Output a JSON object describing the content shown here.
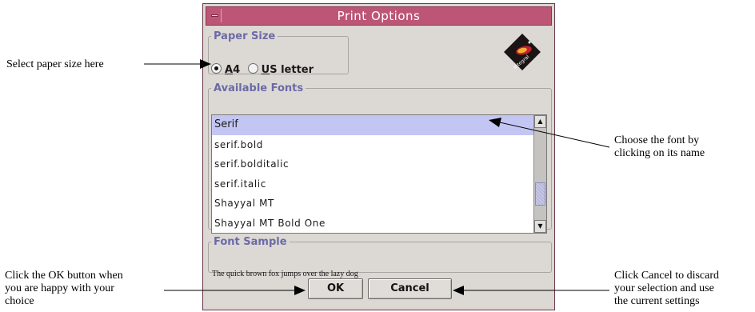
{
  "window": {
    "title": "Print Options"
  },
  "paper_size": {
    "legend": "Paper Size",
    "options": [
      {
        "label_underlined": "A",
        "label_rest": "4",
        "checked": true
      },
      {
        "label_underlined": "U",
        "label_rest": "S letter",
        "checked": false
      }
    ]
  },
  "logo": {
    "text": "Integral"
  },
  "fonts": {
    "legend": "Available Fonts",
    "items": [
      "Serif",
      "serif.bold",
      "serif.bolditalic",
      "serif.italic",
      "Shayyal MT",
      "Shayyal MT Bold One"
    ],
    "selected": "Serif"
  },
  "sample": {
    "legend": "Font Sample",
    "text": "The quick brown fox jumps over the lazy dog"
  },
  "buttons": {
    "ok": "OK",
    "cancel": "Cancel"
  },
  "callouts": {
    "paper": "Select paper size here",
    "font_line1": "Choose the font by",
    "font_line2": "clicking on its name",
    "ok_line1": "Click the OK button when",
    "ok_line2": "you are happy with your",
    "ok_line3": "choice",
    "cancel_line1": "Click Cancel to discard",
    "cancel_line2": "your selection and use",
    "cancel_line3": "the current settings"
  }
}
